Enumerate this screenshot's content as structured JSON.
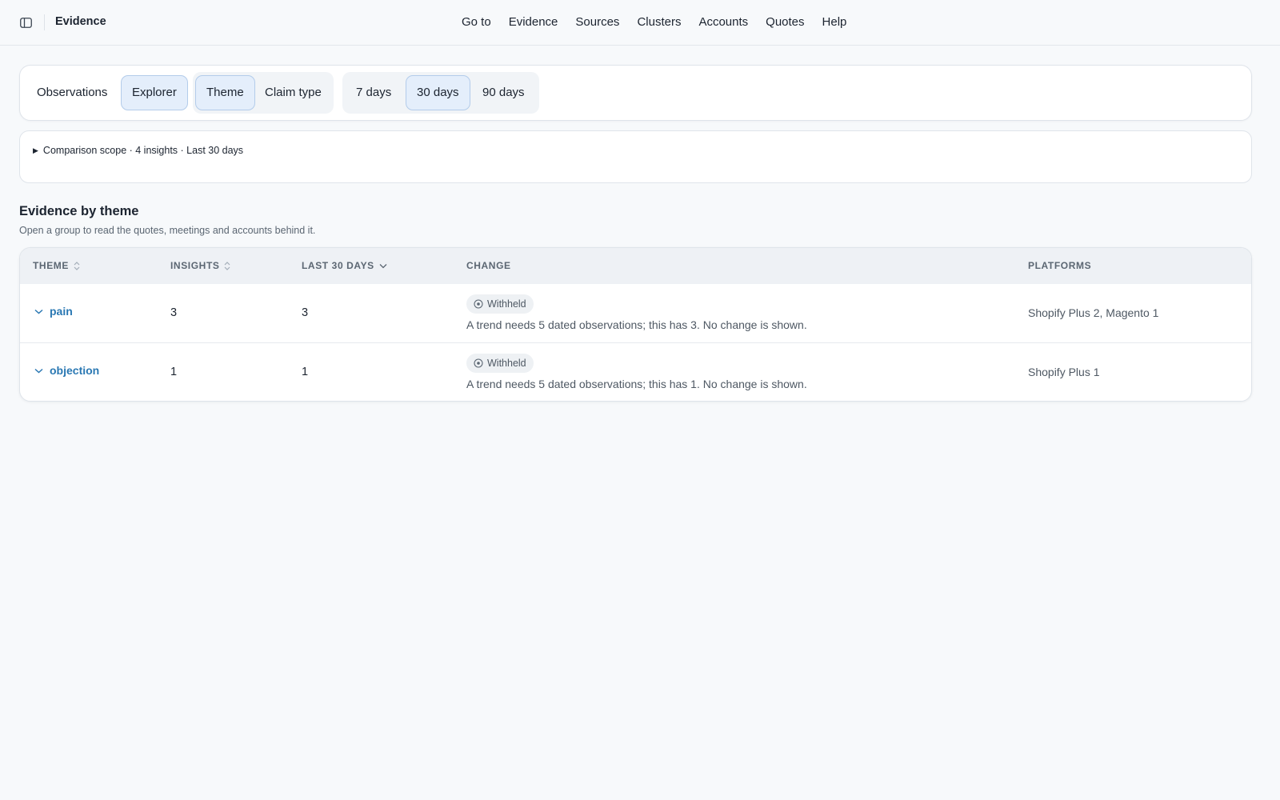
{
  "app": {
    "title": "Evidence"
  },
  "nav": [
    "Go to",
    "Evidence",
    "Sources",
    "Clusters",
    "Accounts",
    "Quotes",
    "Help"
  ],
  "toolbar": {
    "observations": "Observations",
    "explorer": "Explorer",
    "group_by": [
      "Theme",
      "Claim type"
    ],
    "group_by_selected": "Theme",
    "ranges": [
      "7 days",
      "30 days",
      "90 days"
    ],
    "range_selected": "30 days"
  },
  "scope": {
    "summary": "Comparison scope · 4 insights · Last 30 days"
  },
  "section": {
    "title": "Evidence by theme",
    "subtitle": "Open a group to read the quotes, meetings and accounts behind it."
  },
  "table": {
    "headers": {
      "theme": "THEME",
      "insights": "INSIGHTS",
      "last30": "LAST 30 DAYS",
      "change": "CHANGE",
      "platforms": "PLATFORMS"
    },
    "rows": [
      {
        "theme": "pain",
        "insights": "3",
        "last30": "3",
        "badge": "Withheld",
        "change": "A trend needs 5 dated observations; this has 3. No change is shown.",
        "platforms": "Shopify Plus 2, Magento 1"
      },
      {
        "theme": "objection",
        "insights": "1",
        "last30": "1",
        "badge": "Withheld",
        "change": "A trend needs 5 dated observations; this has 1. No change is shown.",
        "platforms": "Shopify Plus 1"
      }
    ]
  },
  "colors": {
    "accent": "#2a78b3",
    "active_bg": "#e4eefb",
    "background": "#f7f9fb"
  }
}
